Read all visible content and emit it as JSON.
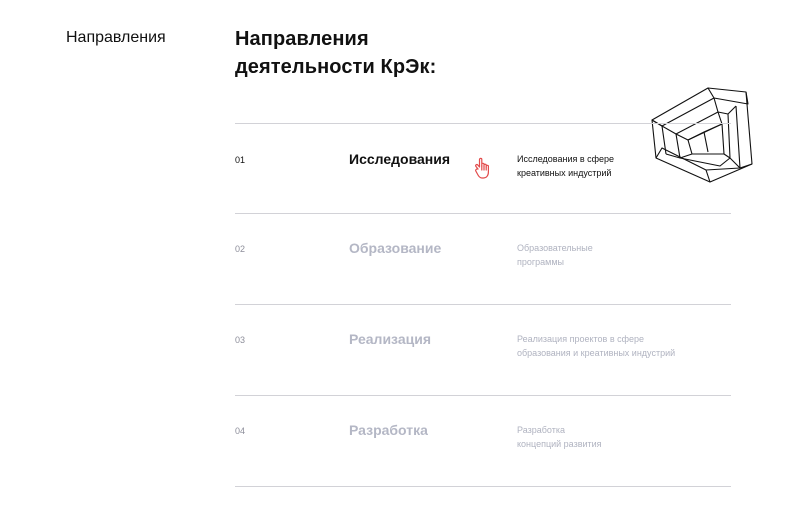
{
  "sidebar": {
    "label": "Направления"
  },
  "header": {
    "title_line1": "Направления",
    "title_line2": "деятельности КрЭк:"
  },
  "directions": [
    {
      "num": "01",
      "title": "Исследования",
      "desc_line1": "Исследования в сфере",
      "desc_line2": "креативных индустрий",
      "active": true
    },
    {
      "num": "02",
      "title": "Образование",
      "desc_line1": "Образовательные",
      "desc_line2": "программы",
      "active": false
    },
    {
      "num": "03",
      "title": "Реализация",
      "desc_line1": "Реализация проектов в сфере",
      "desc_line2": "образования и креативных индустрий",
      "active": false
    },
    {
      "num": "04",
      "title": "Разработка",
      "desc_line1": "Разработка",
      "desc_line2": "концепций развития",
      "active": false
    }
  ],
  "colors": {
    "active_text": "#111111",
    "inactive_title": "#b4b7c5",
    "inactive_desc": "#b0b3c0",
    "divider": "#d2d2d7",
    "cursor": "#e24b4b"
  },
  "icons": {
    "logo": "impossible-triangle-logo",
    "cursor": "hand-pointer-icon"
  }
}
